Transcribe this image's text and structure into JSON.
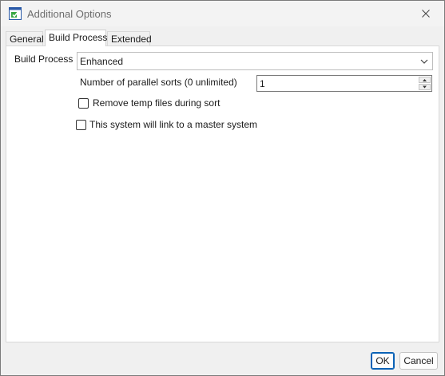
{
  "window": {
    "title": "Additional Options"
  },
  "tabs": [
    {
      "label": "General",
      "active": false
    },
    {
      "label": "Build Process",
      "active": true
    },
    {
      "label": "Extended",
      "active": false
    }
  ],
  "build_process": {
    "label": "Build Process",
    "selected_value": "Enhanced",
    "parallel_sorts": {
      "label": "Number of parallel sorts (0 unlimited)",
      "value": "1"
    },
    "remove_temp_files": {
      "label": "Remove temp files during sort",
      "checked": false
    },
    "link_master_system": {
      "label": "This system will link to a master system",
      "checked": false
    }
  },
  "footer": {
    "ok_label": "OK",
    "cancel_label": "Cancel"
  },
  "colors": {
    "default_button_border": "#0a62b6",
    "window_background": "#f0f0f0",
    "panel_background": "#ffffff"
  },
  "icons": {
    "app": "app-window-icon",
    "close": "close-icon",
    "dropdown": "chevron-down-icon",
    "spin_up": "spin-up-arrow-icon",
    "spin_down": "spin-down-arrow-icon"
  }
}
